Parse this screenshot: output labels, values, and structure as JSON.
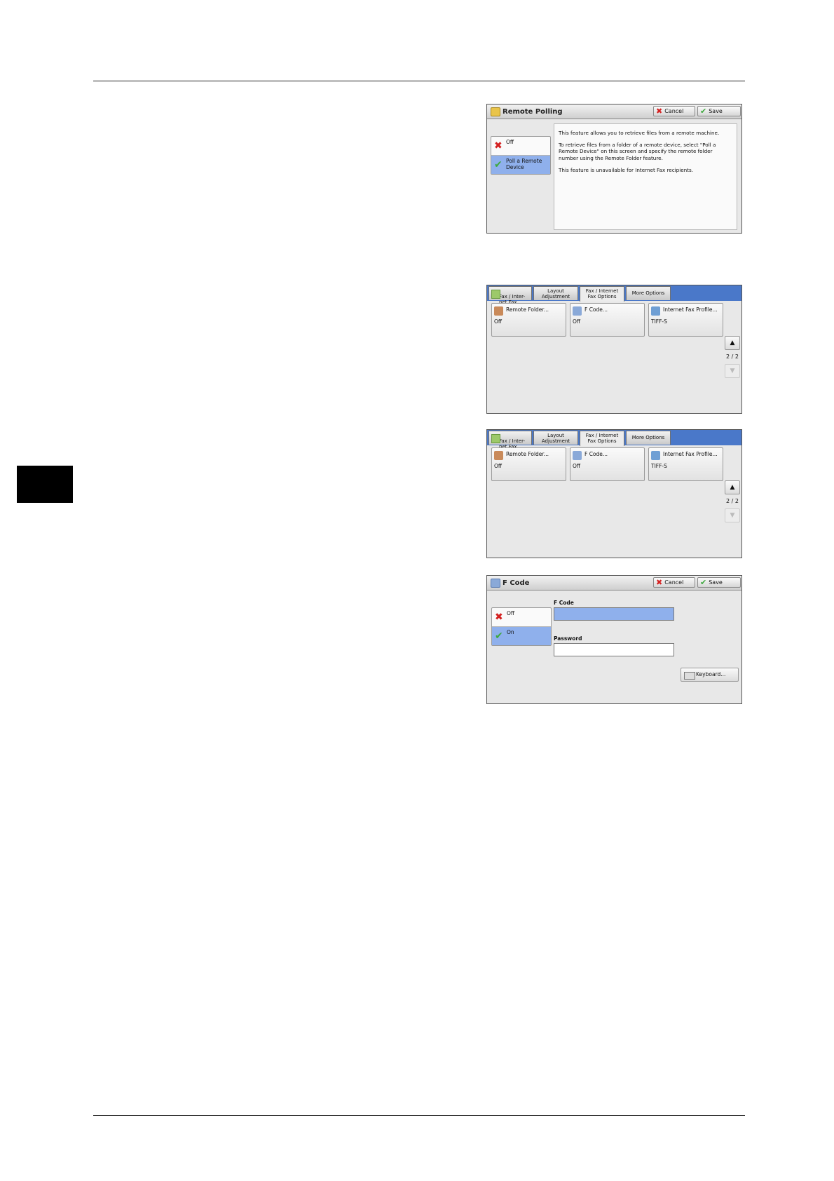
{
  "remote_polling": {
    "title": "Remote Polling",
    "cancel": "Cancel",
    "save": "Save",
    "options": [
      {
        "label": "Off",
        "icon": "x-icon",
        "selected": false
      },
      {
        "label": "Poll a Remote Device",
        "icon": "check-icon",
        "selected": true
      }
    ],
    "description": [
      "This feature allows you to retrieve files from a remote machine.",
      "To retrieve files from a folder of a remote device, select \"Poll a Remote Device\" on this screen and specify the remote folder number using the Remote Folder feature.",
      "This feature is unavailable for Internet Fax recipients."
    ]
  },
  "options_screens": [
    {
      "tabs": [
        "Fax / Inter-\nnet Fax",
        "Layout\nAdjustment",
        "Fax / Internet\nFax Options",
        "More Options"
      ],
      "active_tab": 2,
      "features": [
        {
          "label": "Remote Folder...",
          "value": "Off",
          "icon": "person-folder-icon"
        },
        {
          "label": "F Code...",
          "value": "Off",
          "icon": "fcode-icon"
        },
        {
          "label": "Internet Fax Profile...",
          "value": "TIFF-S",
          "icon": "profile-icon"
        }
      ],
      "page": "2 / 2"
    },
    {
      "tabs": [
        "Fax / Inter-\nnet Fax",
        "Layout\nAdjustment",
        "Fax / Internet\nFax Options",
        "More Options"
      ],
      "active_tab": 2,
      "features": [
        {
          "label": "Remote Folder...",
          "value": "Off",
          "icon": "person-folder-icon"
        },
        {
          "label": "F Code...",
          "value": "Off",
          "icon": "fcode-icon"
        },
        {
          "label": "Internet Fax Profile...",
          "value": "TIFF-S",
          "icon": "profile-icon"
        }
      ],
      "page": "2 / 2"
    }
  ],
  "fcode": {
    "title": "F Code",
    "cancel": "Cancel",
    "save": "Save",
    "options": [
      {
        "label": "Off",
        "icon": "x-icon",
        "selected": false
      },
      {
        "label": "On",
        "icon": "check-icon",
        "selected": true
      }
    ],
    "fcode_label": "F Code",
    "fcode_value": "",
    "password_label": "Password",
    "password_value": "",
    "keyboard": "Keyboard..."
  },
  "colors": {
    "selected_blue": "#8fb0ec",
    "tabbar_blue": "#4a78c9",
    "cancel_red": "#d42020",
    "save_green": "#3ea83e"
  }
}
